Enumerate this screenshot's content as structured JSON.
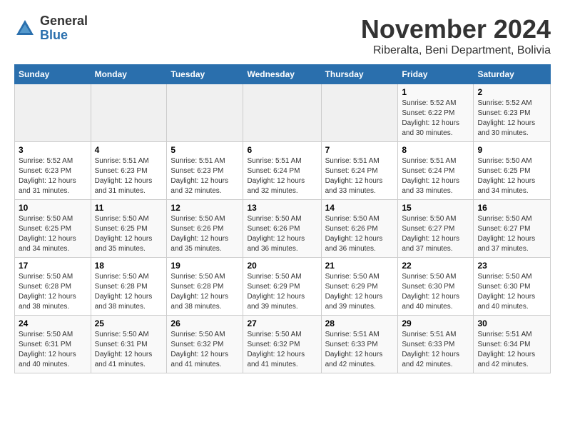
{
  "logo": {
    "general": "General",
    "blue": "Blue"
  },
  "title": "November 2024",
  "subtitle": "Riberalta, Beni Department, Bolivia",
  "days_of_week": [
    "Sunday",
    "Monday",
    "Tuesday",
    "Wednesday",
    "Thursday",
    "Friday",
    "Saturday"
  ],
  "weeks": [
    [
      {
        "day": "",
        "info": ""
      },
      {
        "day": "",
        "info": ""
      },
      {
        "day": "",
        "info": ""
      },
      {
        "day": "",
        "info": ""
      },
      {
        "day": "",
        "info": ""
      },
      {
        "day": "1",
        "info": "Sunrise: 5:52 AM\nSunset: 6:22 PM\nDaylight: 12 hours and 30 minutes."
      },
      {
        "day": "2",
        "info": "Sunrise: 5:52 AM\nSunset: 6:23 PM\nDaylight: 12 hours and 30 minutes."
      }
    ],
    [
      {
        "day": "3",
        "info": "Sunrise: 5:52 AM\nSunset: 6:23 PM\nDaylight: 12 hours and 31 minutes."
      },
      {
        "day": "4",
        "info": "Sunrise: 5:51 AM\nSunset: 6:23 PM\nDaylight: 12 hours and 31 minutes."
      },
      {
        "day": "5",
        "info": "Sunrise: 5:51 AM\nSunset: 6:23 PM\nDaylight: 12 hours and 32 minutes."
      },
      {
        "day": "6",
        "info": "Sunrise: 5:51 AM\nSunset: 6:24 PM\nDaylight: 12 hours and 32 minutes."
      },
      {
        "day": "7",
        "info": "Sunrise: 5:51 AM\nSunset: 6:24 PM\nDaylight: 12 hours and 33 minutes."
      },
      {
        "day": "8",
        "info": "Sunrise: 5:51 AM\nSunset: 6:24 PM\nDaylight: 12 hours and 33 minutes."
      },
      {
        "day": "9",
        "info": "Sunrise: 5:50 AM\nSunset: 6:25 PM\nDaylight: 12 hours and 34 minutes."
      }
    ],
    [
      {
        "day": "10",
        "info": "Sunrise: 5:50 AM\nSunset: 6:25 PM\nDaylight: 12 hours and 34 minutes."
      },
      {
        "day": "11",
        "info": "Sunrise: 5:50 AM\nSunset: 6:25 PM\nDaylight: 12 hours and 35 minutes."
      },
      {
        "day": "12",
        "info": "Sunrise: 5:50 AM\nSunset: 6:26 PM\nDaylight: 12 hours and 35 minutes."
      },
      {
        "day": "13",
        "info": "Sunrise: 5:50 AM\nSunset: 6:26 PM\nDaylight: 12 hours and 36 minutes."
      },
      {
        "day": "14",
        "info": "Sunrise: 5:50 AM\nSunset: 6:26 PM\nDaylight: 12 hours and 36 minutes."
      },
      {
        "day": "15",
        "info": "Sunrise: 5:50 AM\nSunset: 6:27 PM\nDaylight: 12 hours and 37 minutes."
      },
      {
        "day": "16",
        "info": "Sunrise: 5:50 AM\nSunset: 6:27 PM\nDaylight: 12 hours and 37 minutes."
      }
    ],
    [
      {
        "day": "17",
        "info": "Sunrise: 5:50 AM\nSunset: 6:28 PM\nDaylight: 12 hours and 38 minutes."
      },
      {
        "day": "18",
        "info": "Sunrise: 5:50 AM\nSunset: 6:28 PM\nDaylight: 12 hours and 38 minutes."
      },
      {
        "day": "19",
        "info": "Sunrise: 5:50 AM\nSunset: 6:28 PM\nDaylight: 12 hours and 38 minutes."
      },
      {
        "day": "20",
        "info": "Sunrise: 5:50 AM\nSunset: 6:29 PM\nDaylight: 12 hours and 39 minutes."
      },
      {
        "day": "21",
        "info": "Sunrise: 5:50 AM\nSunset: 6:29 PM\nDaylight: 12 hours and 39 minutes."
      },
      {
        "day": "22",
        "info": "Sunrise: 5:50 AM\nSunset: 6:30 PM\nDaylight: 12 hours and 40 minutes."
      },
      {
        "day": "23",
        "info": "Sunrise: 5:50 AM\nSunset: 6:30 PM\nDaylight: 12 hours and 40 minutes."
      }
    ],
    [
      {
        "day": "24",
        "info": "Sunrise: 5:50 AM\nSunset: 6:31 PM\nDaylight: 12 hours and 40 minutes."
      },
      {
        "day": "25",
        "info": "Sunrise: 5:50 AM\nSunset: 6:31 PM\nDaylight: 12 hours and 41 minutes."
      },
      {
        "day": "26",
        "info": "Sunrise: 5:50 AM\nSunset: 6:32 PM\nDaylight: 12 hours and 41 minutes."
      },
      {
        "day": "27",
        "info": "Sunrise: 5:50 AM\nSunset: 6:32 PM\nDaylight: 12 hours and 41 minutes."
      },
      {
        "day": "28",
        "info": "Sunrise: 5:51 AM\nSunset: 6:33 PM\nDaylight: 12 hours and 42 minutes."
      },
      {
        "day": "29",
        "info": "Sunrise: 5:51 AM\nSunset: 6:33 PM\nDaylight: 12 hours and 42 minutes."
      },
      {
        "day": "30",
        "info": "Sunrise: 5:51 AM\nSunset: 6:34 PM\nDaylight: 12 hours and 42 minutes."
      }
    ]
  ]
}
